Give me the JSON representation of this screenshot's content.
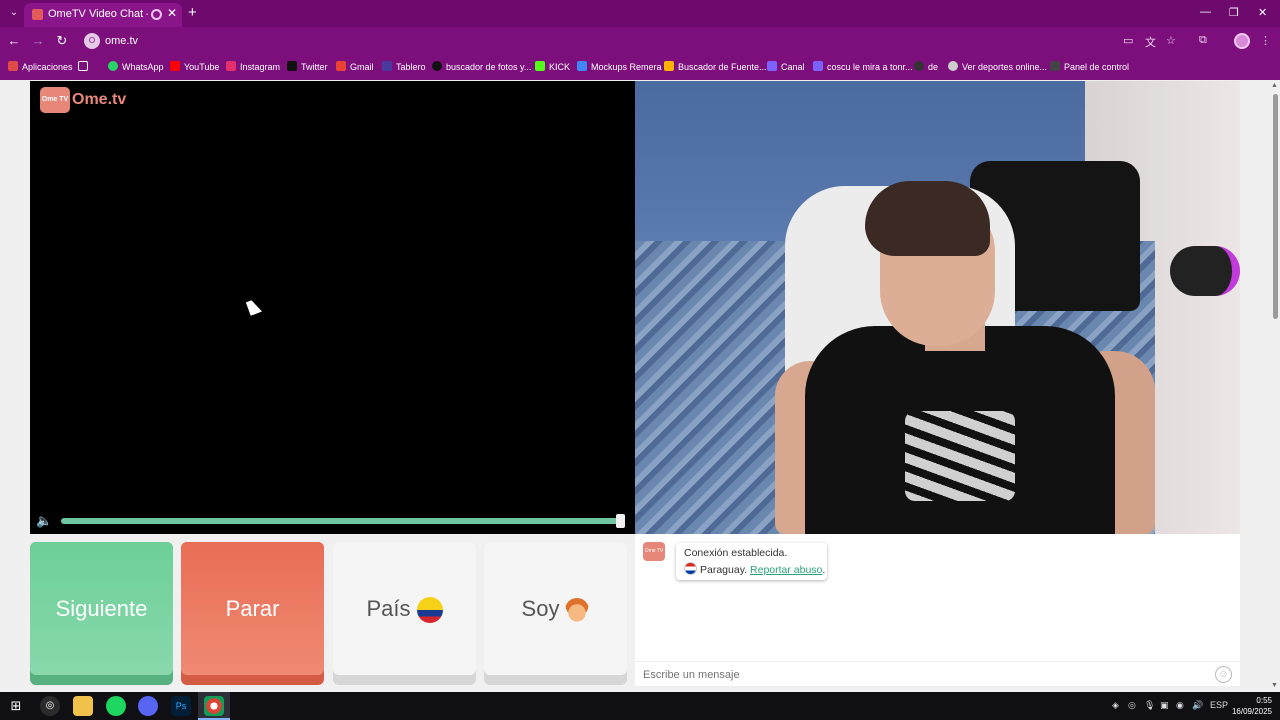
{
  "browser": {
    "tab_title": "OmeTV Video Chat — Ome",
    "url": "ome.tv",
    "site_icon_text": "O",
    "window_controls": [
      "—",
      "❐",
      "✕"
    ],
    "bookmarks": [
      {
        "label": "Aplicaciones",
        "color": "#e04a4a"
      },
      {
        "label": "",
        "color": "#ffffff"
      },
      {
        "label": "WhatsApp",
        "color": "#25d366"
      },
      {
        "label": "YouTube",
        "color": "#ff0000"
      },
      {
        "label": "Instagram",
        "color": "#e1306c"
      },
      {
        "label": "Twitter",
        "color": "#111111"
      },
      {
        "label": "Gmail",
        "color": "#ea4335"
      },
      {
        "label": "Tablero",
        "color": "#4a3aa0"
      },
      {
        "label": "buscador de fotos y...",
        "color": "#111111"
      },
      {
        "label": "KICK",
        "color": "#53fc18"
      },
      {
        "label": "Mockups Remera",
        "color": "#4285f4"
      },
      {
        "label": "Buscador de Fuente...",
        "color": "#ffb300"
      },
      {
        "label": "Canal",
        "color": "#7b61ff"
      },
      {
        "label": "coscu le mira a tonr...",
        "color": "#7b61ff"
      },
      {
        "label": "de",
        "color": "#333333"
      },
      {
        "label": "Ver deportes online...",
        "color": "#cccccc"
      },
      {
        "label": "Panel de control",
        "color": "#444444"
      }
    ]
  },
  "logo": {
    "badge": "Ome TV",
    "name": "Ome.tv"
  },
  "controls": {
    "next": "Siguiente",
    "stop": "Parar",
    "country": "País",
    "gender": "Soy"
  },
  "chat": {
    "logo_text": "Ome TV",
    "status": "Conexión establecida.",
    "country": "Paraguay.",
    "report": "Reportar abuso",
    "report_suffix": ".",
    "input_placeholder": "Escribe un mensaje"
  },
  "taskbar": {
    "time": "0:55",
    "date": "16/09/2025",
    "language": "ESP"
  }
}
